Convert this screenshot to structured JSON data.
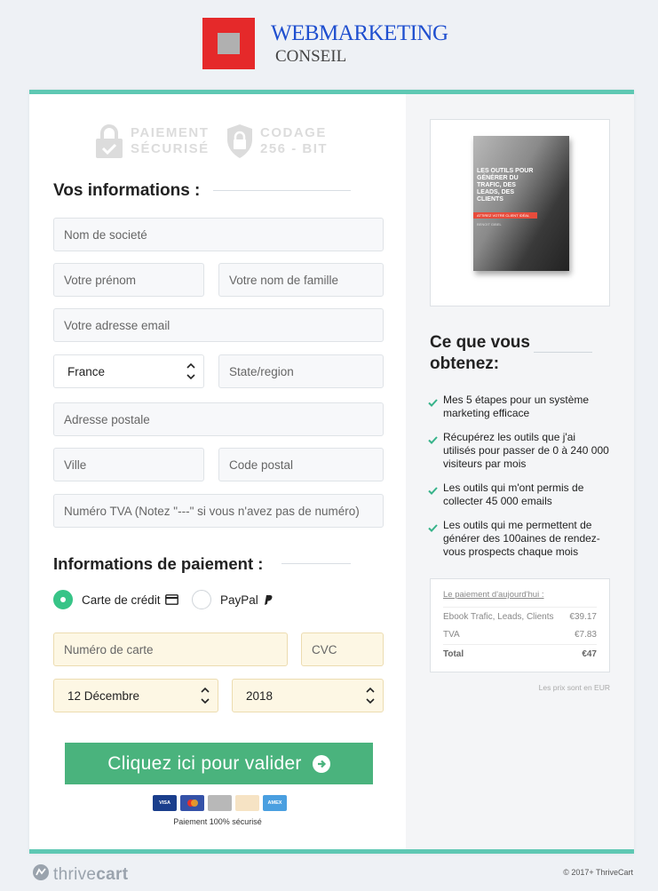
{
  "brand": {
    "line1": "WEBMARKETING",
    "line2": "CONSEIL"
  },
  "badges": {
    "secure_line1": "PAIEMENT",
    "secure_line2": "SÉCURISÉ",
    "encoding_line1": "CODAGE",
    "encoding_line2": "256 - BIT"
  },
  "info_section": {
    "title": "Vos informations :",
    "company_placeholder": "Nom de societé",
    "firstname_placeholder": "Votre prénom",
    "lastname_placeholder": "Votre nom de famille",
    "email_placeholder": "Votre adresse email",
    "country_value": "France",
    "state_placeholder": "State/region",
    "address_placeholder": "Adresse postale",
    "city_placeholder": "Ville",
    "zip_placeholder": "Code postal",
    "vat_placeholder": "Numéro TVA (Notez \"---\" si vous n'avez pas de numéro)"
  },
  "payment_section": {
    "title": "Informations de paiement :",
    "method_card_label": "Carte de crédit",
    "method_paypal_label": "PayPal",
    "selected_method": "card",
    "card_number_placeholder": "Numéro de carte",
    "cvc_placeholder": "CVC",
    "expiry_month_value": "12 Décembre",
    "expiry_year_value": "2018",
    "submit_label": "Cliquez ici pour valider",
    "card_logos": [
      "VISA",
      "Mastercard",
      "Discover",
      "Discover",
      "AMEX"
    ],
    "secure_note": "Paiement 100% sécurisé"
  },
  "product": {
    "ebook_title": "LES OUTILS POUR GÉNÉRER DU TRAFIC, DES LEADS, DES CLIENTS",
    "ebook_band": "ATTIREZ VOTRE CLIENT IDÉAL",
    "ebook_author": "BENOIT GIBEL"
  },
  "benefits_section": {
    "title": "Ce que vous obtenez:",
    "items": [
      "Mes 5 étapes pour un système marketing efficace",
      "Récupérez les outils que j'ai utilisés pour passer de 0 à 240 000 visiteurs par mois",
      "Les outils qui m'ont permis de collecter 45 000 emails",
      "Les outils qui me permettent de générer des 100aines de rendez-vous prospects chaque mois"
    ]
  },
  "summary": {
    "heading": "Le paiement d'aujourd'hui :",
    "rows": [
      {
        "label": "Ebook Trafic, Leads, Clients",
        "value": "€39.17"
      },
      {
        "label": "TVA",
        "value": "€7.83"
      },
      {
        "label": "Total",
        "value": "€47"
      }
    ],
    "currency_note": "Les prix sont en EUR"
  },
  "footer": {
    "brand_part1": "thrive",
    "brand_part2": "cart",
    "copyright": "© 2017+ ThriveCart"
  },
  "colors": {
    "accent_green": "#4ab37d",
    "teal_border": "#5ec8b3",
    "brand_red": "#e5292a",
    "brand_blue": "#1f4fcf"
  }
}
